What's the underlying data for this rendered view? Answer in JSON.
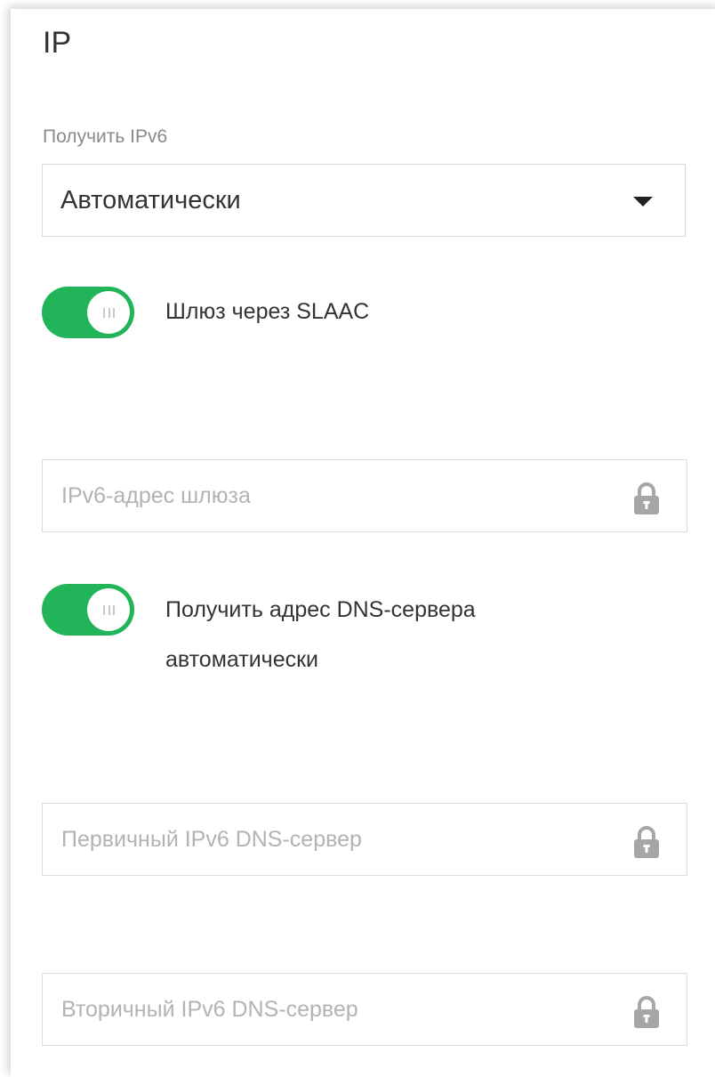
{
  "section": {
    "title": "IP"
  },
  "ipv6_mode": {
    "label": "Получить IPv6",
    "selected": "Автоматически"
  },
  "slaac_toggle": {
    "label": "Шлюз через SLAAC",
    "state": "on"
  },
  "gateway_input": {
    "placeholder": "IPv6-адрес шлюза",
    "locked": true
  },
  "dns_auto_toggle": {
    "label_line1": "Получить адрес DNS-сервера",
    "label_line2": "автоматически",
    "state": "on"
  },
  "primary_dns_input": {
    "placeholder": "Первичный IPv6 DNS-сервер",
    "locked": true
  },
  "secondary_dns_input": {
    "placeholder": "Вторичный IPv6 DNS-сервер",
    "locked": true
  },
  "colors": {
    "toggle_on": "#21b459",
    "text": "#333333",
    "muted": "#8a8a8a",
    "placeholder": "#b3b3b3",
    "border": "#dcdcdc"
  },
  "icons": {
    "dropdown": "caret-down-icon",
    "lock": "lock-icon"
  }
}
